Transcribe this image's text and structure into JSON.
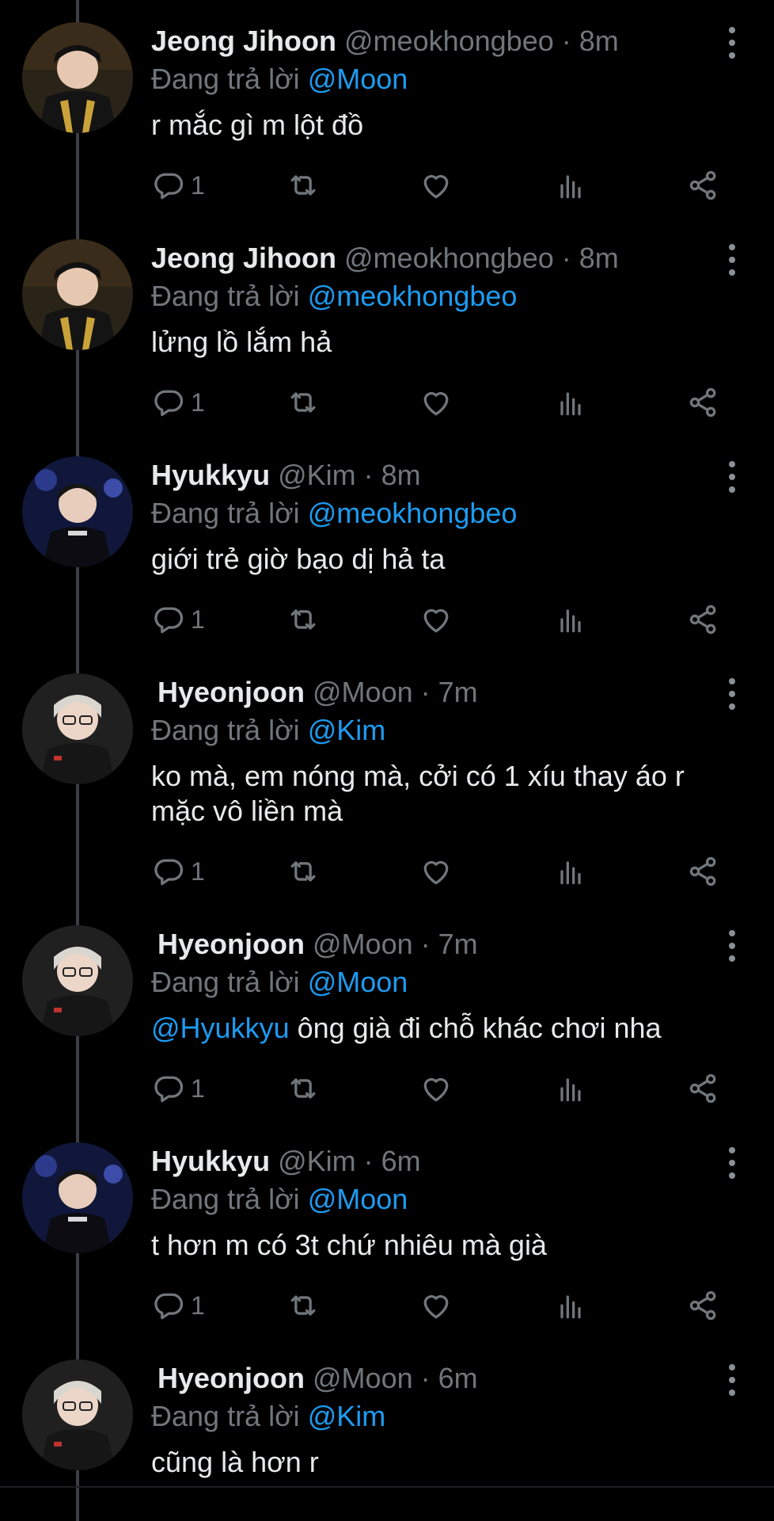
{
  "colors": {
    "background": "#000000",
    "primary_text": "#e7e9ea",
    "secondary_text": "#71767b",
    "accent": "#1d9bf0",
    "thread_line": "#3b3f44"
  },
  "icons": {
    "reply": "reply-icon",
    "retweet": "retweet-icon",
    "like": "heart-icon",
    "views": "analytics-icon",
    "share": "share-icon",
    "more": "more-vertical-icon"
  },
  "replying_prefix": "Đang trả lời",
  "tweets": [
    {
      "name": "Jeong Jihoon",
      "handle": "@meokhongbeo",
      "dot": " · ",
      "time": "8m",
      "reply_to": "@Moon",
      "body_pre": "",
      "body_text": "r mắc gì m lột đồ",
      "reply_count": "1"
    },
    {
      "name": "Jeong Jihoon",
      "handle": "@meokhongbeo",
      "dot": " · ",
      "time": "8m",
      "reply_to": "@meokhongbeo",
      "body_pre": "",
      "body_text": "lửng lồ lắm hả",
      "reply_count": "1"
    },
    {
      "name": "Hyukkyu",
      "handle": "@Kim",
      "dot": " · ",
      "time": "8m",
      "reply_to": "@meokhongbeo",
      "body_pre": "",
      "body_text": "giới trẻ giờ bạo dị hả ta",
      "reply_count": "1"
    },
    {
      "name": "Hyeonjoon",
      "handle": "@Moon",
      "dot": " · ",
      "time": "7m",
      "reply_to": "@Kim",
      "body_pre": "",
      "body_text": "ko mà, em nóng mà, cởi có 1 xíu thay áo r mặc vô liền mà",
      "reply_count": "1"
    },
    {
      "name": "Hyeonjoon",
      "handle": "@Moon",
      "dot": " · ",
      "time": "7m",
      "reply_to": "@Moon",
      "body_pre": "@Hyukkyu",
      "body_text": " ông già đi chỗ khác chơi nha",
      "reply_count": "1"
    },
    {
      "name": "Hyukkyu",
      "handle": "@Kim",
      "dot": " · ",
      "time": "6m",
      "reply_to": "@Moon",
      "body_pre": "",
      "body_text": "t hơn m có 3t chứ nhiêu mà già",
      "reply_count": "1"
    },
    {
      "name": "Hyeonjoon",
      "handle": "@Moon",
      "dot": " · ",
      "time": "6m",
      "reply_to": "@Kim",
      "body_pre": "",
      "body_text": "cũng là hơn r",
      "reply_count": ""
    }
  ]
}
